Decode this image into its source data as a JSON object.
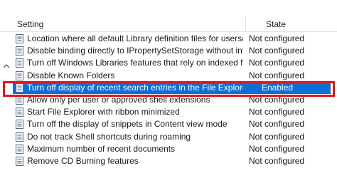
{
  "header": {
    "setting_label": "Setting",
    "state_label": "State"
  },
  "rows": [
    {
      "setting": "Location where all default Library definition files for users/m...",
      "state": "Not configured"
    },
    {
      "setting": "Disable binding directly to IPropertySetStorage without inter...",
      "state": "Not configured"
    },
    {
      "setting": "Turn off Windows Libraries features that rely on indexed file ...",
      "state": "Not configured"
    },
    {
      "setting": "Disable Known Folders",
      "state": "Not configured"
    },
    {
      "setting": "Turn off display of recent search entries in the File Explorer s...",
      "state": "Enabled"
    },
    {
      "setting": "Allow only per user or approved shell extensions",
      "state": "Not configured"
    },
    {
      "setting": "Start File Explorer with ribbon minimized",
      "state": "Not configured"
    },
    {
      "setting": "Turn off the display of snippets in Content view mode",
      "state": "Not configured"
    },
    {
      "setting": "Do not track Shell shortcuts during roaming",
      "state": "Not configured"
    },
    {
      "setting": "Maximum number of recent documents",
      "state": "Not configured"
    },
    {
      "setting": "Remove CD Burning features",
      "state": "Not configured"
    }
  ],
  "selected_index": 4,
  "colors": {
    "selection": "#0c6fd6",
    "highlight_outline": "#e0141e"
  },
  "icons": {
    "row_icon": "policy-setting-icon",
    "collapse_icon": "chevron-up-icon"
  }
}
